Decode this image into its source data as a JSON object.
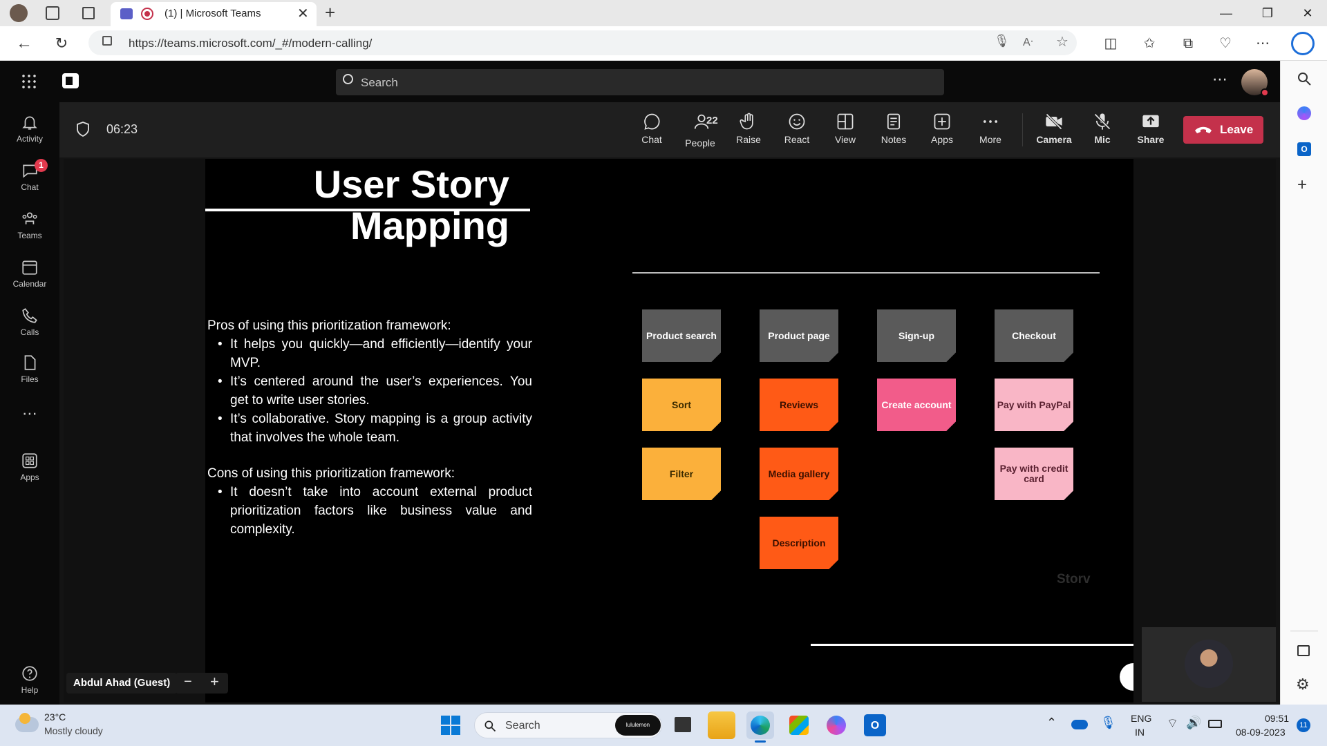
{
  "browser": {
    "tab_title": "(1) | Microsoft Teams",
    "url": "https://teams.microsoft.com/_#/modern-calling/"
  },
  "teams": {
    "search_placeholder": "Search",
    "timer": "06:23",
    "rail": [
      {
        "label": "Activity",
        "icon": "bell-icon"
      },
      {
        "label": "Chat",
        "icon": "chat-icon",
        "badge": "1"
      },
      {
        "label": "Teams",
        "icon": "teams-icon"
      },
      {
        "label": "Calendar",
        "icon": "calendar-icon"
      },
      {
        "label": "Calls",
        "icon": "phone-icon"
      },
      {
        "label": "Files",
        "icon": "file-icon"
      },
      {
        "label": "Apps",
        "icon": "apps-icon"
      },
      {
        "label": "Help",
        "icon": "help-icon"
      }
    ],
    "controls": [
      {
        "label": "Chat",
        "icon": "chat-icon"
      },
      {
        "label": "People",
        "icon": "people-icon",
        "count": "22"
      },
      {
        "label": "Raise",
        "icon": "hand-icon"
      },
      {
        "label": "React",
        "icon": "smile-icon"
      },
      {
        "label": "View",
        "icon": "view-icon"
      },
      {
        "label": "Notes",
        "icon": "notes-icon"
      },
      {
        "label": "Apps",
        "icon": "apps-plus-icon"
      },
      {
        "label": "More",
        "icon": "more-icon"
      },
      {
        "label": "Camera",
        "icon": "camera-off-icon"
      },
      {
        "label": "Mic",
        "icon": "mic-off-icon"
      },
      {
        "label": "Share",
        "icon": "share-icon"
      }
    ],
    "leave_label": "Leave",
    "presenter_name": "Abdul Ahad (Guest)"
  },
  "slide": {
    "title_line1": "User Story",
    "title_line2": "Mapping",
    "pros_heading": "Pros of using this prioritization framework:",
    "pros": [
      "It helps you quickly—and efficiently—identify your MVP.",
      "It’s centered around the user’s experiences. You get to write user stories.",
      "It’s collaborative. Story mapping is a group activity that involves the whole team."
    ],
    "cons_heading": "Cons of using this prioritization framework:",
    "cons": [
      "It doesn’t take into account external product prioritization factors like business value and complexity."
    ],
    "notes": [
      {
        "text": "Product search",
        "color": "#5a5a5a",
        "fg": "#ffffff"
      },
      {
        "text": "Product page",
        "color": "#5a5a5a",
        "fg": "#ffffff"
      },
      {
        "text": "Sign-up",
        "color": "#5a5a5a",
        "fg": "#ffffff"
      },
      {
        "text": "Checkout",
        "color": "#5a5a5a",
        "fg": "#ffffff"
      },
      {
        "text": "Sort",
        "color": "#fbb03b",
        "fg": "#3a2a00"
      },
      {
        "text": "Reviews",
        "color": "#ff5a16",
        "fg": "#3a1000"
      },
      {
        "text": "Create account",
        "color": "#f25c8a",
        "fg": "#ffffff"
      },
      {
        "text": "Pay with PayPal",
        "color": "#f9b6c6",
        "fg": "#5a2030"
      },
      {
        "text": "Filter",
        "color": "#fbb03b",
        "fg": "#3a2a00"
      },
      {
        "text": "Media gallery",
        "color": "#ff5a16",
        "fg": "#3a1000"
      },
      {
        "text": "Pay with credit card",
        "color": "#f9b6c6",
        "fg": "#5a2030"
      },
      {
        "text": "Description",
        "color": "#ff5a16",
        "fg": "#3a1000"
      }
    ],
    "watermark": "Storv"
  },
  "taskbar": {
    "temperature": "23°C",
    "weather": "Mostly cloudy",
    "search_label": "Search",
    "lang_line1": "ENG",
    "lang_line2": "IN",
    "time": "09:51",
    "date": "08-09-2023",
    "notif_count": "11",
    "pill_text": "lululemon"
  }
}
